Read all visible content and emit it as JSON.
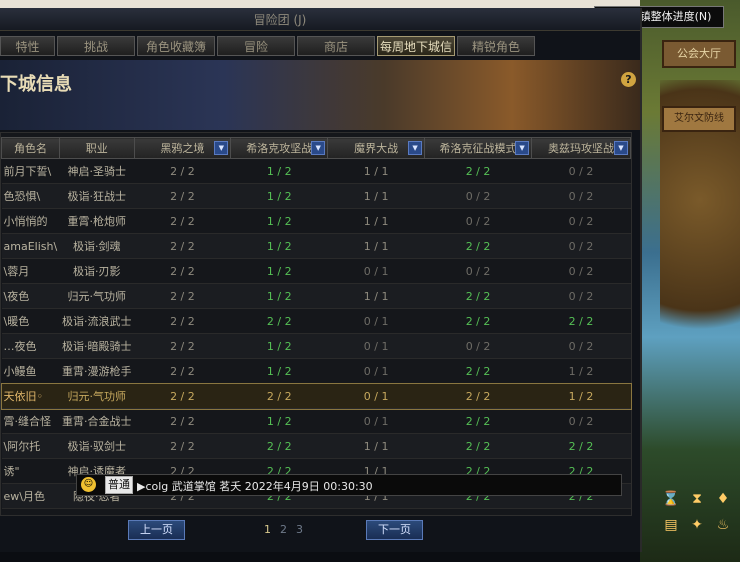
{
  "progress_button": "查看城镇整体进度(N)",
  "window_title": "冒险团 (J)",
  "tabs": [
    "特性",
    "挑战",
    "角色收藏簿",
    "冒险",
    "商店",
    "每周地下城信息",
    "精锐角色"
  ],
  "active_tab": "每周地下城信息",
  "banner_title": "下城信息",
  "help_label": "?",
  "columns": [
    "角色名",
    "职业",
    "黑鸦之境",
    "希洛克攻坚战",
    "魔界大战",
    "希洛克征战模式",
    "奥兹玛攻坚战"
  ],
  "rows": [
    {
      "name": "前月下誓\\",
      "job": "神启·圣骑士",
      "c1": "2 / 2",
      "c2": "1 / 2",
      "c3": "1 / 1",
      "c4": "2 / 2",
      "c5": "0 / 2"
    },
    {
      "name": "色恐惧\\",
      "job": "极诣·狂战士",
      "c1": "2 / 2",
      "c2": "1 / 2",
      "c3": "1 / 1",
      "c4": "0 / 2",
      "c5": "0 / 2"
    },
    {
      "name": "小悄悄的",
      "job": "重霄·枪炮师",
      "c1": "2 / 2",
      "c2": "1 / 2",
      "c3": "1 / 1",
      "c4": "0 / 2",
      "c5": "0 / 2"
    },
    {
      "name": "amaElish\\",
      "job": "极诣·剑魂",
      "c1": "2 / 2",
      "c2": "1 / 2",
      "c3": "1 / 1",
      "c4": "2 / 2",
      "c5": "0 / 2"
    },
    {
      "name": "\\蓉月",
      "job": "极诣·刃影",
      "c1": "2 / 2",
      "c2": "1 / 2",
      "c3": "0 / 1",
      "c4": "0 / 2",
      "c5": "0 / 2"
    },
    {
      "name": "\\夜色",
      "job": "归元·气功师",
      "c1": "2 / 2",
      "c2": "1 / 2",
      "c3": "1 / 1",
      "c4": "2 / 2",
      "c5": "0 / 2"
    },
    {
      "name": "\\暖色",
      "job": "极诣·流浪武士",
      "c1": "2 / 2",
      "c2": "2 / 2",
      "c3": "0 / 1",
      "c4": "2 / 2",
      "c5": "2 / 2"
    },
    {
      "name": "…夜色",
      "job": "极诣·暗殿骑士",
      "c1": "2 / 2",
      "c2": "1 / 2",
      "c3": "0 / 1",
      "c4": "0 / 2",
      "c5": "0 / 2"
    },
    {
      "name": "小鳗鱼",
      "job": "重霄·漫游枪手",
      "c1": "2 / 2",
      "c2": "1 / 2",
      "c3": "0 / 1",
      "c4": "2 / 2",
      "c5": "1 / 2"
    },
    {
      "name": "天依旧◦",
      "job": "归元·气功师",
      "c1": "2 / 2",
      "c2": "2 / 2",
      "c3": "0 / 1",
      "c4": "2 / 2",
      "c5": "1 / 2"
    },
    {
      "name": "霄·缝合怪",
      "job": "重霄·合金战士",
      "c1": "2 / 2",
      "c2": "1 / 2",
      "c3": "0 / 1",
      "c4": "2 / 2",
      "c5": "0 / 2"
    },
    {
      "name": "\\阿尔托",
      "job": "极诣·驭剑士",
      "c1": "2 / 2",
      "c2": "2 / 2",
      "c3": "1 / 1",
      "c4": "2 / 2",
      "c5": "2 / 2"
    },
    {
      "name": "诱\"",
      "job": "神启·诱魔者",
      "c1": "2 / 2",
      "c2": "2 / 2",
      "c3": "1 / 1",
      "c4": "2 / 2",
      "c5": "2 / 2"
    },
    {
      "name": "ew\\月色",
      "job": "隐夜·忍者",
      "c1": "2 / 2",
      "c2": "2 / 2",
      "c3": "1 / 1",
      "c4": "2 / 2",
      "c5": "2 / 2"
    }
  ],
  "selected_row": 9,
  "pager": {
    "prev": "上一页",
    "next": "下一页",
    "pages": [
      "1",
      "2",
      "3"
    ],
    "current": "1"
  },
  "chat": {
    "channel": "普通",
    "text": "▶colg  武道掌馆  茗夭  2022年4月9日 00:30:30"
  },
  "scene_sign": "公会大厅",
  "scene_sign2": "艾尔文防线"
}
